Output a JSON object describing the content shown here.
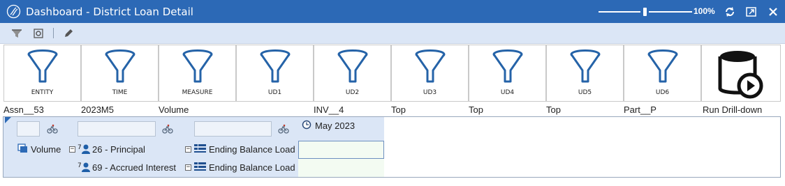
{
  "window": {
    "title": "Dashboard - District Loan Detail",
    "zoom_label": "100%"
  },
  "toolbar": {
    "items": [
      "filter-icon",
      "settings-icon",
      "edit-icon"
    ]
  },
  "filters": [
    {
      "label": "ENTITY",
      "value": "Assn__53"
    },
    {
      "label": "TIME",
      "value": "2023M5"
    },
    {
      "label": "MEASURE",
      "value": "Volume"
    },
    {
      "label": "UD1",
      "value": ""
    },
    {
      "label": "UD2",
      "value": "INV__4"
    },
    {
      "label": "UD3",
      "value": "Top"
    },
    {
      "label": "UD4",
      "value": "Top"
    },
    {
      "label": "UD5",
      "value": "Top"
    },
    {
      "label": "UD6",
      "value": "Part__P"
    }
  ],
  "run_button": {
    "label": "Run Drill-down"
  },
  "grid": {
    "column_header": "May 2023",
    "rows": [
      {
        "measure": "Volume",
        "entity_code": "26 - Principal",
        "account": "Ending Balance Load",
        "value": ""
      },
      {
        "measure": "",
        "entity_code": "69 - Accrued Interest",
        "account": "Ending Balance Load",
        "value": ""
      }
    ]
  },
  "colors": {
    "titlebar": "#2c69b6",
    "toolbar": "#dbe6f6",
    "grid_header": "#dbe6f6",
    "cell_bg": "#f3fbf2"
  }
}
